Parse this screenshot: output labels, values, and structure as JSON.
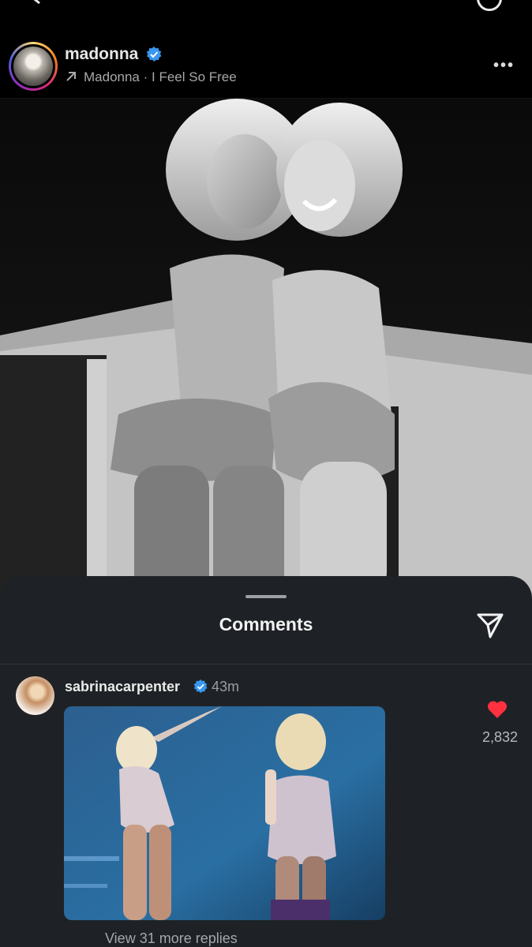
{
  "post": {
    "username": "madonna",
    "audio_line": "Madonna · I Feel So Free",
    "more_label": "•••"
  },
  "comments_sheet": {
    "title": "Comments"
  },
  "comment": {
    "username": "sabrinacarpenter",
    "time": "43m",
    "likes": "2,832",
    "view_replies": "View 31 more replies"
  },
  "colors": {
    "background": "#000000",
    "sheet": "#1e2226",
    "verified": "#3897f0",
    "heart": "#ff3040"
  }
}
